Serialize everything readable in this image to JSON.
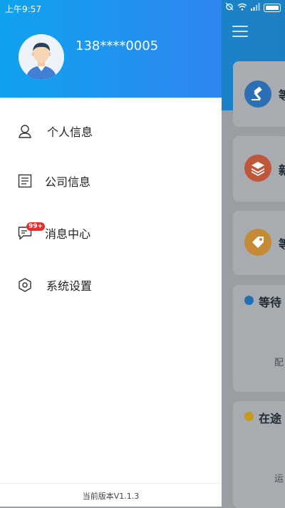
{
  "status_bar": {
    "time": "上午9:57"
  },
  "drawer": {
    "user": {
      "phone": "138****0005"
    },
    "menu_items": [
      {
        "label": "个人信息",
        "icon": "person-icon"
      },
      {
        "label": "公司信息",
        "icon": "building-doc-icon"
      },
      {
        "label": "消息中心",
        "icon": "message-icon",
        "badge": "99+"
      },
      {
        "label": "系统设置",
        "icon": "settings-hexagon-icon"
      }
    ],
    "version": "当前版本V1.1.3"
  },
  "background": {
    "cards": [
      {
        "text": "等",
        "icon": "gavel-icon",
        "color": "#2d6fb5"
      },
      {
        "text": "新",
        "icon": "layers-icon",
        "color": "#c0563a"
      },
      {
        "text": "等",
        "icon": "tag-icon",
        "color": "#c48a35"
      }
    ],
    "sections": [
      {
        "title": "等待",
        "sub": "配",
        "color": "#1f6fb5"
      },
      {
        "title": "在途",
        "sub": "运",
        "color": "#c79a1a"
      }
    ]
  },
  "colors": {
    "drawer_header_start": "#0fa3ee",
    "drawer_header_end": "#2f86f0",
    "badge": "#e82a2a"
  }
}
